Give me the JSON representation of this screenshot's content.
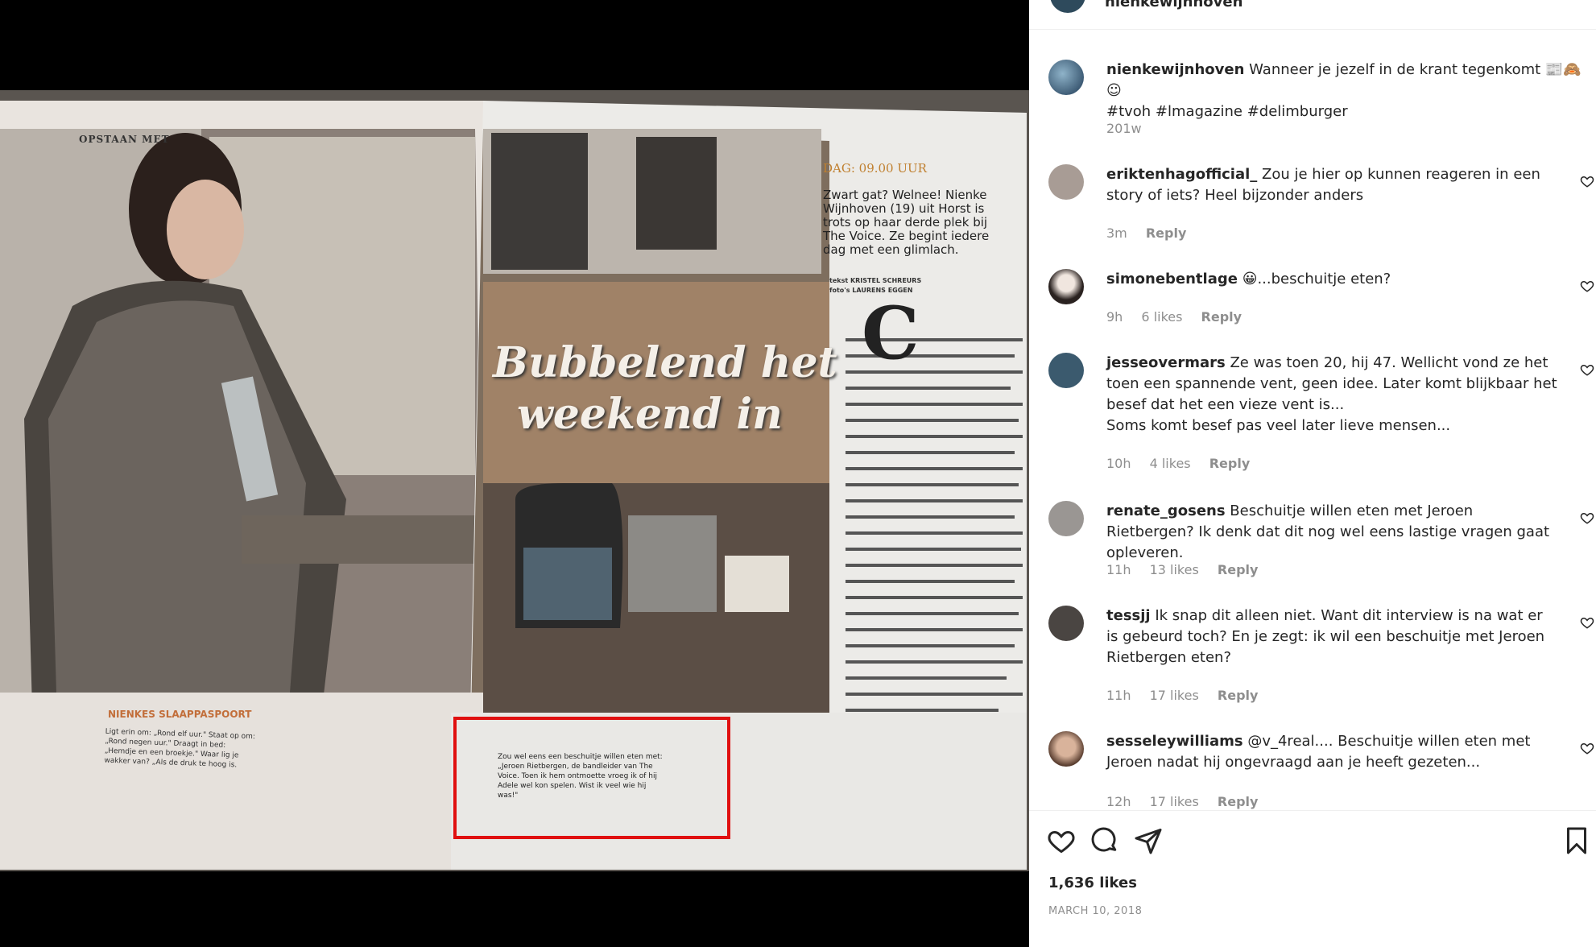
{
  "post": {
    "header_username": "nienkewijnhoven",
    "caption_username": "nienkewijnhoven",
    "caption_text": "Wanneer je jezelf in de krant tegenkomt 📰🙈☺",
    "caption_tags": "#tvoh #lmagazine #delimburger",
    "caption_age": "201w",
    "likes": "1,636 likes",
    "date": "MARCH 10, 2018"
  },
  "magazine": {
    "section": "OPSTAAN MET",
    "time": "DAG: 09.00 UUR",
    "intro": "Zwart gat? Welnee! Nienke Wijnhoven (19) uit Horst is trots op haar derde plek bij The Voice. Ze begint iedere dag met een glimlach.",
    "credits_1": "tekst KRISTEL SCHREURS",
    "credits_2": "foto's LAURENS EGGEN",
    "headline_1": "Bubbelend het",
    "headline_2": "weekend in",
    "sidebar_title": "NIENKES SLAAPPASPOORT",
    "sidebar_text": "Ligt erin om: „Rond elf uur.\" Staat op om: „Rond negen uur.\" Draagt in bed: „Hemdje en een broekje.\" Waar lig je wakker van? „Als de druk te hoog is.",
    "quote_text": "Zou wel eens een beschuitje willen eten met: „Jeroen Rietbergen, de bandleider van The Voice. Toen ik hem ontmoette vroeg ik of hij Adele wel kon spelen. Wist ik veel wie hij was!\""
  },
  "comments": [
    {
      "user": "eriktenhagofficial_",
      "text": "Zou je hier op kunnen reageren in een story of iets? Heel bijzonder anders",
      "age": "3m",
      "likes": "",
      "reply": "Reply"
    },
    {
      "user": "simonebentlage",
      "text": "😀...beschuitje eten?",
      "age": "9h",
      "likes": "6 likes",
      "reply": "Reply"
    },
    {
      "user": "jesseovermars",
      "text": "Ze was toen 20, hij 47. Wellicht vond ze het toen een spannende vent, geen idee. Later komt blijkbaar het besef dat het een vieze vent is...",
      "text2": "Soms komt besef pas veel later lieve mensen...",
      "age": "10h",
      "likes": "4 likes",
      "reply": "Reply"
    },
    {
      "user": "renate_gosens",
      "text": "Beschuitje willen eten met Jeroen Rietbergen? Ik denk dat dit nog wel eens lastige vragen gaat opleveren.",
      "age": "11h",
      "likes": "13 likes",
      "reply": "Reply"
    },
    {
      "user": "tessjj",
      "text": "Ik snap dit alleen niet. Want dit interview is na wat er is gebeurd toch? En je zegt: ik wil een beschuitje met Jeroen Rietbergen eten?",
      "age": "11h",
      "likes": "17 likes",
      "reply": "Reply"
    },
    {
      "user": "sesseleywilliams",
      "text": "@v_4real.... Beschuitje willen eten met Jeroen nadat hij ongevraagd aan je heeft gezeten...",
      "age": "12h",
      "likes": "17 likes",
      "reply": "Reply"
    }
  ],
  "icons": {
    "like": "heart-icon",
    "comment": "comment-icon",
    "share": "paper-plane-icon",
    "save": "bookmark-icon"
  },
  "colors": {
    "highlight_box": "#e01010",
    "text": "#262626",
    "muted": "#8e8e8e"
  }
}
